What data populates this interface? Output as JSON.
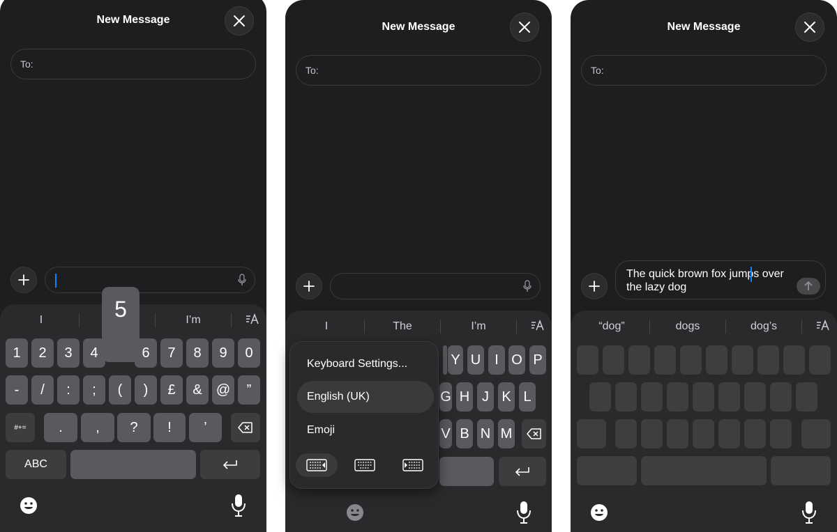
{
  "panel1": {
    "title": "New Message",
    "to_label": "To:",
    "suggestions": [
      "I",
      "",
      "I’m"
    ],
    "popup_key": "5",
    "row1": [
      "1",
      "2",
      "3",
      "4",
      "",
      "6",
      "7",
      "8",
      "9",
      "0"
    ],
    "row2": [
      "-",
      "/",
      ":",
      ";",
      "(",
      ")",
      "£",
      "&",
      "@",
      "”"
    ],
    "row3_toggle": "#+=",
    "row3": [
      ".",
      ",",
      "?",
      "!",
      "’"
    ],
    "abc_label": "ABC"
  },
  "panel2": {
    "title": "New Message",
    "to_label": "To:",
    "suggestions": [
      "I",
      "The",
      "I’m"
    ],
    "menu": {
      "settings": "Keyboard Settings...",
      "language": "English (UK)",
      "emoji": "Emoji"
    },
    "row1_visible": [
      "Y",
      "U",
      "I",
      "O",
      "P"
    ],
    "row2_visible": [
      "G",
      "H",
      "J",
      "K",
      "L"
    ],
    "row3_visible": [
      "V",
      "B",
      "N",
      "M"
    ]
  },
  "panel3": {
    "title": "New Message",
    "to_label": "To:",
    "message_line1": "The quick brown fox jumps over",
    "message_line2": "the lazy dog",
    "suggestions": [
      "“dog”",
      "dogs",
      "dog’s"
    ]
  },
  "icons": {
    "close": "close-icon",
    "plus": "plus-icon",
    "mic": "microphone-icon",
    "emoji": "emoji-icon",
    "delete": "delete-key-icon",
    "return": "return-key-icon",
    "format": "text-format-icon",
    "send": "send-arrow-icon"
  },
  "colors": {
    "background": "#1e1e20",
    "keyboard": "#2a2a2c",
    "key": "#5a5a5e",
    "caret": "#0a84ff"
  }
}
